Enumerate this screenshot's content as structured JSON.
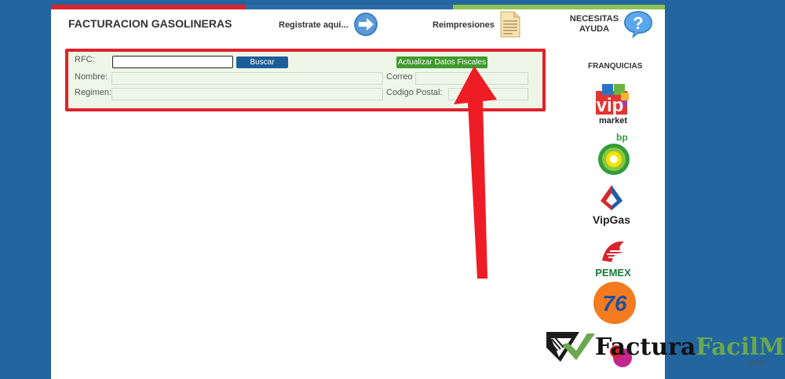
{
  "header": {
    "title": "FACTURACION GASOLINERAS",
    "register_link": "Registrate aqui...",
    "reprint_link": "Reimpresiones",
    "help_line1": "NECESITAS",
    "help_line2": "AYUDA"
  },
  "form": {
    "rfc_label": "RFC:",
    "rfc_value": "",
    "search_button": "Buscar",
    "update_button": "Actualizar Datos Fiscales",
    "name_label": "Nombre:",
    "email_label": "Correo",
    "regime_label": "Regimen:",
    "postal_label": "Codigo Postal:"
  },
  "sidebar": {
    "title": "FRANQUICIAS",
    "logos": {
      "vip_market_caption": "market",
      "vip_market_mark": "vip",
      "bp_caption": "bp",
      "vipgas_caption": "VipGas",
      "pemex_caption": "PEMEX",
      "seventysix_mark": "76"
    }
  },
  "watermark": {
    "text_dark": "Factura",
    "text_accent": "Facil",
    "text_dark2": "MX",
    "suffix": ".COM"
  },
  "colors": {
    "background": "#22659f",
    "accent_red": "#d9232d",
    "accent_blue": "#2c6aa6",
    "accent_green": "#8cc152",
    "button_blue": "#1d5e9a",
    "button_green": "#3f9a2c",
    "highlight": "#e0222a"
  }
}
